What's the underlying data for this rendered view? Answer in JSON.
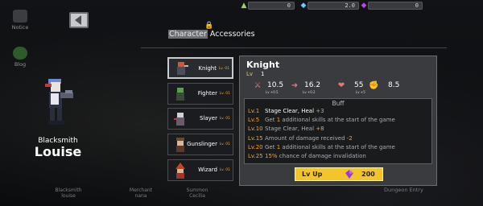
{
  "resources": [
    {
      "icon": "tree-icon",
      "value": "0"
    },
    {
      "icon": "diamond-icon",
      "value": "2.0"
    },
    {
      "icon": "gem-icon",
      "value": "0"
    }
  ],
  "side_menu": [
    {
      "label": "Notice"
    },
    {
      "label": "Blog"
    }
  ],
  "tabs": {
    "character": "Character",
    "accessories": "Accessories"
  },
  "hero": {
    "class": "Blacksmith",
    "name": "Louise"
  },
  "bottom_labels": {
    "blacksmith": {
      "role": "Blacksmith",
      "name": "louise"
    },
    "merchant": {
      "role": "Merchant",
      "name": "nana"
    },
    "summon": {
      "role": "Summon",
      "name": "Cecilia"
    },
    "dungeon": "Dungeon Entry"
  },
  "classes": [
    {
      "name": "Knight",
      "level": "Lv. 01"
    },
    {
      "name": "Fighter",
      "level": "Lv. 01"
    },
    {
      "name": "Slayer",
      "level": "Lv. 01"
    },
    {
      "name": "Gunslinger",
      "level": "Lv. 01"
    },
    {
      "name": "Wizard",
      "level": "Lv. 01"
    }
  ],
  "detail": {
    "name": "Knight",
    "lv_label": "Lv",
    "lv_value": "1",
    "stats": [
      {
        "icon": "sword-icon",
        "value": "10.5",
        "sub": "Lv +0.5"
      },
      {
        "icon": "lightning-icon",
        "value": "16.2",
        "sub": "Lv +0.2"
      },
      {
        "icon": "heart-icon",
        "value": "55",
        "sub": "Lv +5"
      },
      {
        "icon": "fist-icon",
        "value": "8.5",
        "sub": ""
      }
    ],
    "buff_title": "Buff",
    "buffs": [
      {
        "lv": "Lv.1",
        "pre": "Stage Clear, Heal ",
        "num": "+3",
        "post": "",
        "active": true
      },
      {
        "lv": "Lv.5",
        "pre": "Get ",
        "num": "1",
        "post": " additional skills at the start of the game",
        "active": false
      },
      {
        "lv": "Lv.10",
        "pre": "Stage Clear, Heal ",
        "num": "+8",
        "post": "",
        "active": false
      },
      {
        "lv": "Lv.15",
        "pre": "Amount of damage received ",
        "num": "-2",
        "post": "",
        "active": false
      },
      {
        "lv": "Lv.20",
        "pre": "Get ",
        "num": "1",
        "post": " additional skills at the start of the game",
        "active": false
      },
      {
        "lv": "Lv.25",
        "pre": "",
        "num": "15%",
        "post": " chance of damage invalidation",
        "active": false
      }
    ],
    "lvup_label": "Lv Up",
    "lvup_cost": "200"
  },
  "colors": {
    "accent_orange": "#f2a33a",
    "button_yellow": "#f3c52b",
    "panel": "#3a3b3e"
  }
}
